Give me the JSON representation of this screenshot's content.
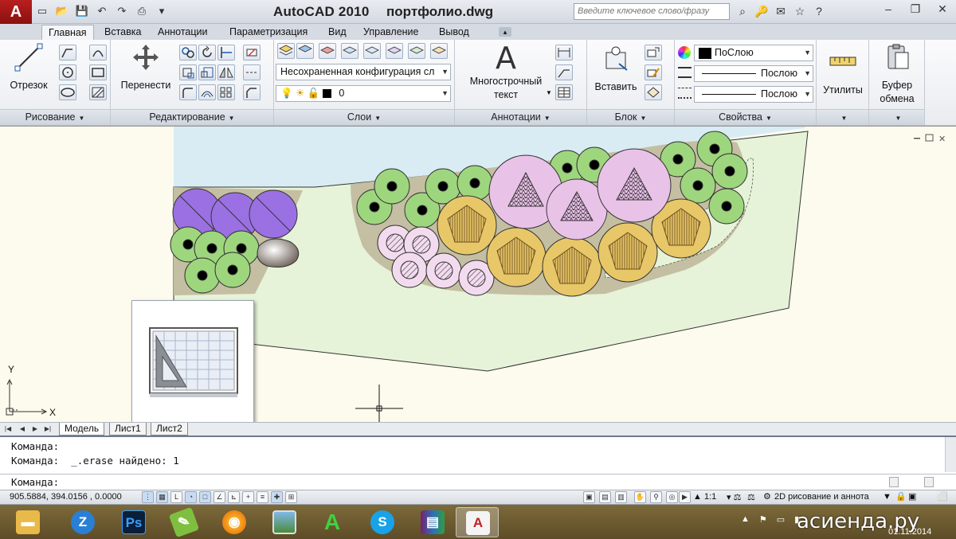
{
  "titlebar": {
    "app_logo": "A",
    "app_name": "AutoCAD 2010",
    "file_name": "портфолио.dwg",
    "search_placeholder": "Введите ключевое слово/фразу"
  },
  "ribbon": {
    "tabs": [
      "Главная",
      "Вставка",
      "Аннотации",
      "Параметризация",
      "Вид",
      "Управление",
      "Вывод"
    ],
    "active_tab": "Главная",
    "panels": {
      "draw": {
        "title": "Рисование",
        "line_label": "Отрезок"
      },
      "modify": {
        "title": "Редактирование",
        "move_label": "Перенести"
      },
      "layers": {
        "title": "Слои",
        "layer_state": "Несохраненная конфигурация сл",
        "current_layer": "0"
      },
      "annotation": {
        "title": "Аннотации",
        "mtext_line1": "Многострочный",
        "mtext_line2": "текст",
        "mtext_glyph": "A"
      },
      "block": {
        "title": "Блок",
        "insert_label": "Вставить"
      },
      "properties": {
        "title": "Свойства",
        "color": "ПоСлою",
        "linetype": "Послою",
        "lineweight": "Послою"
      },
      "utilities": {
        "label": "Утилиты"
      },
      "clipboard": {
        "label_line1": "Буфер",
        "label_line2": "обмена"
      }
    }
  },
  "drawing": {
    "ucs_x": "X",
    "ucs_y": "Y",
    "colors": {
      "water": "#d9ecf4",
      "lawn": "#e6f3d8",
      "soil": "#c4bfa2",
      "shrub_green": "#9ed67e",
      "purple": "#9b70e3",
      "pink_tree": "#e9c2e8",
      "light_pink": "#f3dbef",
      "yellow": "#e8c768"
    }
  },
  "layout_tabs": [
    "Модель",
    "Лист1",
    "Лист2"
  ],
  "active_layout": "Модель",
  "command": {
    "history": [
      "Команда:",
      "Команда:  _.erase найдено: 1"
    ],
    "prompt": "Команда:"
  },
  "statusbar": {
    "coordinates": "905.5884, 394.0156 , 0.0000",
    "scale": "1:1",
    "workspace": "2D рисование и аннота"
  },
  "taskbar": {
    "apps": [
      "folder-icon",
      "zoho-icon",
      "photoshop-icon",
      "notepad-icon",
      "firefox-icon",
      "image-viewer-icon",
      "acrobat-icon",
      "skype-icon",
      "winrar-icon",
      "autocad-icon"
    ],
    "photoshop_label": "Ps",
    "zoho_label": "Z",
    "autocad_label": "A"
  },
  "watermark": {
    "brand": "асиенда.ру",
    "date": "01.11.2014"
  }
}
